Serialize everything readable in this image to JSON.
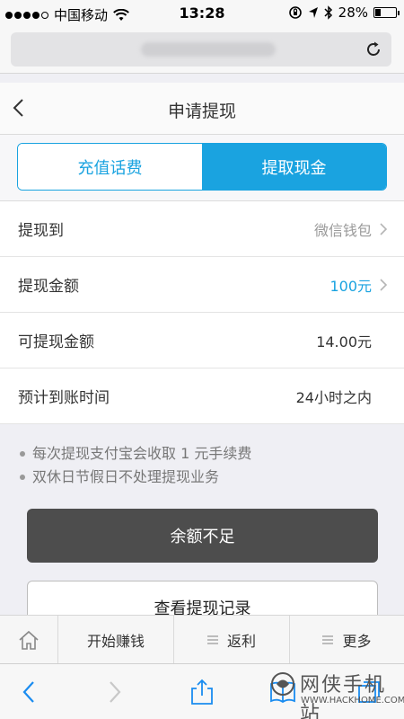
{
  "status_bar": {
    "carrier": "中国移动",
    "time": "13:28",
    "battery": "28%",
    "battery_level": 0.28
  },
  "browser": {
    "reload_icon": "reload-icon"
  },
  "header": {
    "title": "申请提现",
    "back_icon": "chevron-left-icon"
  },
  "tabs": [
    {
      "label": "充值话费",
      "active": false
    },
    {
      "label": "提取现金",
      "active": true
    }
  ],
  "rows": [
    {
      "label": "提现到",
      "value": "微信钱包",
      "chevron": true,
      "style": "grey"
    },
    {
      "label": "提现金额",
      "value": "100元",
      "chevron": true,
      "style": "blue"
    },
    {
      "label": "可提现金额",
      "value": "14.00元",
      "chevron": false,
      "style": "normal"
    },
    {
      "label": "预计到账时间",
      "value": "24小时之内",
      "chevron": false,
      "style": "normal"
    }
  ],
  "notes": [
    "每次提现支付宝会收取 1 元手续费",
    "双休日节假日不处理提现业务"
  ],
  "buttons": {
    "insufficient": "余额不足",
    "records": "查看提现记录"
  },
  "bottom_nav": {
    "home_icon": "home-icon",
    "earn": "开始赚钱",
    "rebate": "返利",
    "more": "更多"
  },
  "watermark": {
    "text": "网侠手机站",
    "sub": "WWW.HACKHOME.COM"
  },
  "colors": {
    "accent": "#1aa3e0",
    "disabled_button": "#4d4d4d"
  }
}
